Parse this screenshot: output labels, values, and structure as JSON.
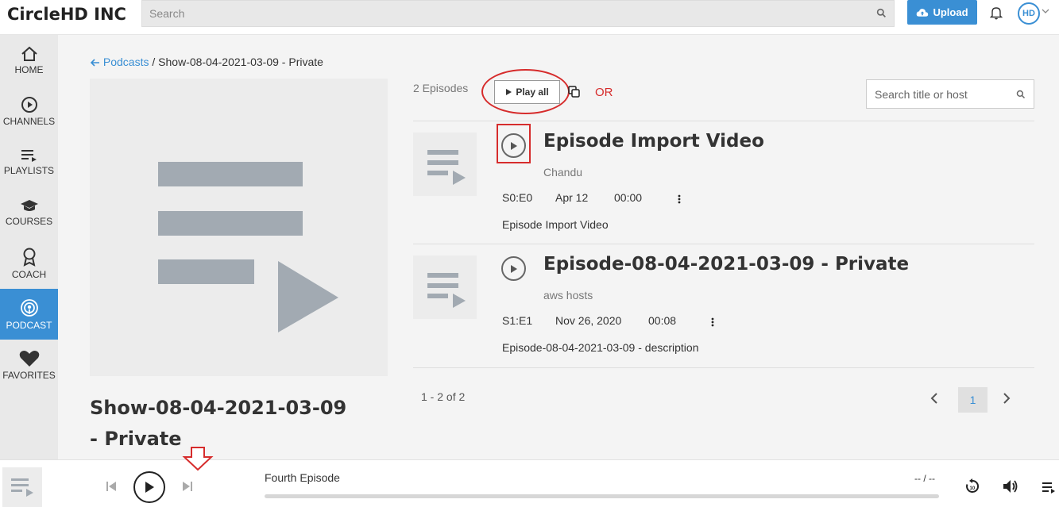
{
  "app": {
    "brand": "CircleHD INC"
  },
  "header": {
    "search_placeholder": "Search",
    "upload_label": "Upload",
    "avatar_text": "HD"
  },
  "sidebar": {
    "items": [
      {
        "label": "HOME",
        "icon": "home-icon",
        "active": false
      },
      {
        "label": "CHANNELS",
        "icon": "channels-icon",
        "active": false
      },
      {
        "label": "PLAYLISTS",
        "icon": "playlists-icon",
        "active": false
      },
      {
        "label": "COURSES",
        "icon": "courses-icon",
        "active": false
      },
      {
        "label": "COACH",
        "icon": "coach-icon",
        "active": false
      },
      {
        "label": "PODCAST",
        "icon": "podcast-icon",
        "active": true
      },
      {
        "label": "FAVORITES",
        "icon": "heart-icon",
        "active": false
      }
    ]
  },
  "breadcrumb": {
    "link_label": "Podcasts",
    "separator": "/",
    "current": "Show-08-04-2021-03-09 - Private"
  },
  "show": {
    "title": "Show-08-04-2021-03-09 - Private"
  },
  "episodes_header": {
    "count_label": "2 Episodes",
    "play_all_label": "Play all",
    "annotation_or": "OR",
    "search_placeholder": "Search title or host"
  },
  "episodes": [
    {
      "title": "Episode Import Video",
      "host": "Chandu",
      "season_episode": "S0:E0",
      "date": "Apr 12",
      "duration": "00:00",
      "description": "Episode Import Video"
    },
    {
      "title": "Episode-08-04-2021-03-09 - Private",
      "host": "aws hosts",
      "season_episode": "S1:E1",
      "date": "Nov 26, 2020",
      "duration": "00:08",
      "description": "Episode-08-04-2021-03-09 - description"
    }
  ],
  "pagination": {
    "range_label": "1 - 2 of 2",
    "current_page": "1"
  },
  "player": {
    "now_playing": "Fourth Episode",
    "time_label": "-- / --",
    "progress": 0
  },
  "colors": {
    "accent": "#3a8fd4",
    "annotation": "#d62c2c"
  }
}
